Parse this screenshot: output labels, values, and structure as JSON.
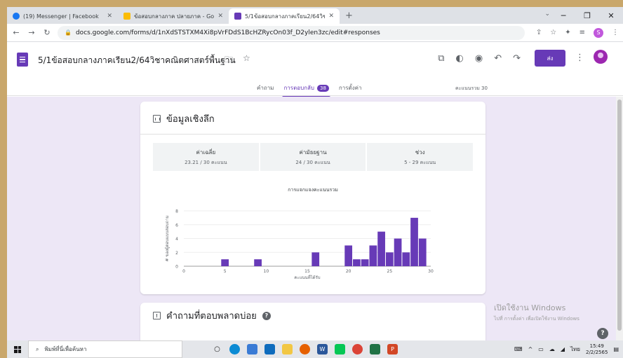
{
  "browser": {
    "tabs": [
      {
        "title": "(19) Messenger | Facebook",
        "favicon_color": "#1877f2"
      },
      {
        "title": "ข้อสอบกลางภาค ปลายภาค - Google",
        "favicon_color": "#fbbc04"
      },
      {
        "title": "5/1ข้อสอบกลางภาคเรียน2/64วิชาคณิ",
        "favicon_color": "#673ab7"
      }
    ],
    "url": "docs.google.com/forms/d/1nXdSTSTXM4Xi8pVrFDdS1BcHZRycOn03f_D2ylen3zc/edit#responses",
    "profile_initial": "S"
  },
  "form": {
    "title": "5/1ข้อสอบกลางภาคเรียน2/64วิชาคณิตศาสตร์พื้นฐาน",
    "send_label": "ส่ง",
    "tabs": {
      "questions": "คำถาม",
      "responses": "การตอบกลับ",
      "responses_count": "38",
      "settings": "การตั้งค่า"
    },
    "total_points": "คะแนนรวม 30"
  },
  "insights": {
    "title": "ข้อมูลเชิงลึก",
    "stats": [
      {
        "label": "ค่าเฉลี่ย",
        "value": "23.21 / 30 คะแนน"
      },
      {
        "label": "ค่ามัธยฐาน",
        "value": "24 / 30 คะแนน"
      },
      {
        "label": "ช่วง",
        "value": "5 - 29 คะแนน"
      }
    ]
  },
  "chart_data": {
    "type": "bar",
    "title": "การแจกแจงคะแนนรวม",
    "xlabel": "คะแนนที่ได้รับ",
    "ylabel": "# ของผู้ตอบแบบสอบถาม",
    "xlim": [
      0,
      30
    ],
    "ylim": [
      0,
      8
    ],
    "xticks": [
      0,
      5,
      10,
      15,
      20,
      25,
      30
    ],
    "yticks": [
      0,
      2,
      4,
      6,
      8
    ],
    "bar_color": "#673ab7",
    "x": [
      5,
      9,
      16,
      20,
      21,
      22,
      23,
      24,
      25,
      26,
      27,
      28,
      29
    ],
    "values": [
      1,
      1,
      2,
      3,
      1,
      1,
      3,
      5,
      2,
      4,
      2,
      7,
      4
    ]
  },
  "missed": {
    "title": "คำถามที่ตอบพลาดบ่อย"
  },
  "watermark": {
    "line1": "เปิดใช้งาน Windows",
    "line2": "ไปที่ การตั้งค่า เพื่อเปิดใช้งาน Windows"
  },
  "taskbar": {
    "search_placeholder": "พิมพ์ที่นี่เพื่อค้นหา",
    "lang": "ไทย",
    "time": "15:49",
    "date": "2/2/2565"
  }
}
